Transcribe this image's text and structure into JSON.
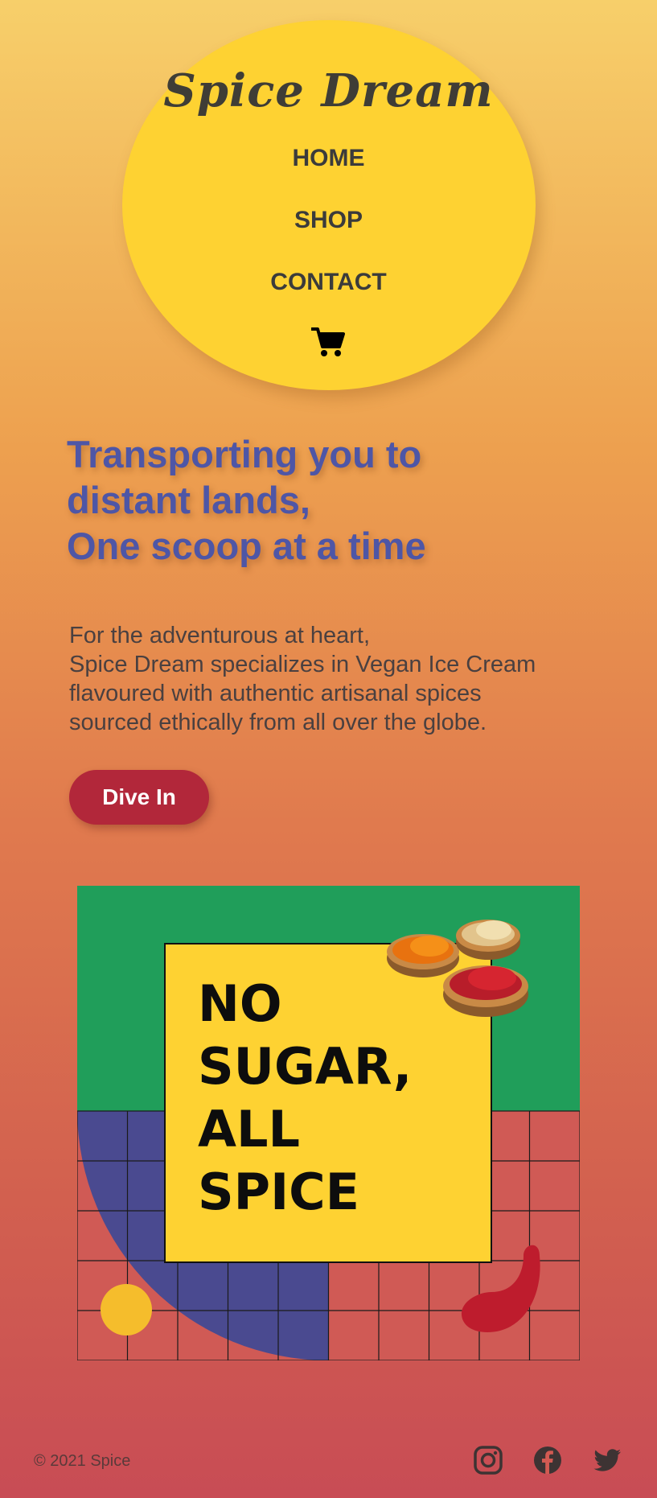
{
  "brand": {
    "name": "Spice Dream"
  },
  "nav": {
    "items": [
      {
        "label": "HOME"
      },
      {
        "label": "SHOP"
      },
      {
        "label": "CONTACT"
      }
    ],
    "cart_icon": "shopping-cart-icon"
  },
  "hero": {
    "headline_lines": [
      "Transporting you to",
      "distant lands,",
      "One scoop at a time"
    ],
    "description_lines": [
      "For the adventurous at heart,",
      "Spice Dream specializes in Vegan Ice Cream",
      "flavoured with authentic artisanal spices",
      "sourced ethically from all over the globe."
    ],
    "cta_label": "Dive In"
  },
  "banner": {
    "text_lines": [
      "NO",
      "SUGAR,",
      "ALL",
      "SPICE"
    ]
  },
  "footer": {
    "copyright": "© 2021 Spice",
    "social_icons": [
      "instagram-icon",
      "facebook-icon",
      "twitter-icon"
    ]
  },
  "colors": {
    "nav_circle": "#fed232",
    "headline": "#4e56a6",
    "cta": "#b2273a",
    "banner_green": "#209e5a",
    "banner_blue": "#4a4a90",
    "banner_red": "#d05a55",
    "banner_yellow": "#fed232"
  }
}
